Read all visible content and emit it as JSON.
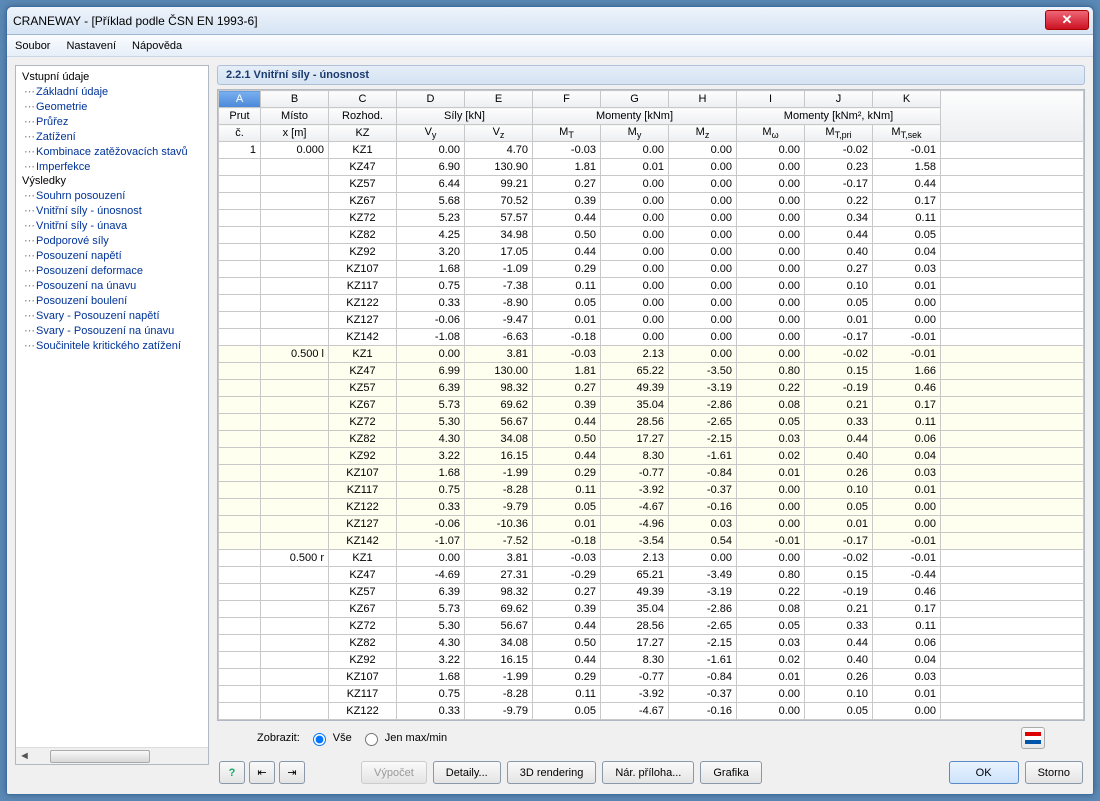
{
  "window": {
    "title": "CRANEWAY - [Příklad podle ČSN EN 1993-6]"
  },
  "menu": {
    "items": [
      "Soubor",
      "Nastavení",
      "Nápověda"
    ]
  },
  "nav": {
    "input_header": "Vstupní údaje",
    "input_items": [
      "Základní údaje",
      "Geometrie",
      "Průřez",
      "Zatížení",
      "Kombinace zatěžovacích stavů",
      "Imperfekce"
    ],
    "results_header": "Výsledky",
    "results_items": [
      "Souhrn posouzení",
      "Vnitřní síly - únosnost",
      "Vnitřní síly - únava",
      "Podporové síly",
      "Posouzení napětí",
      "Posouzení deformace",
      "Posouzení na únavu",
      "Posouzení boulení",
      "Svary - Posouzení napětí",
      "Svary - Posouzení na únavu",
      "Součinitele kritického zatížení"
    ]
  },
  "section": {
    "title": "2.2.1 Vnitřní síly - únosnost"
  },
  "columns": {
    "letters": [
      "A",
      "B",
      "C",
      "D",
      "E",
      "F",
      "G",
      "H",
      "I",
      "J",
      "K"
    ],
    "group_sily": "Síly [kN]",
    "group_momenty1": "Momenty [kNm]",
    "group_momenty2": "Momenty [kNm², kNm]",
    "row2": {
      "prut": "Prut",
      "misto": "Místo",
      "rozhod": "Rozhod."
    },
    "row3": {
      "c": "č.",
      "x": "x [m]",
      "kz": "KZ",
      "vy": "V",
      "vz": "V",
      "mt": "M",
      "my": "M",
      "mz": "M",
      "mw": "M",
      "mtpri": "M",
      "mtsek": "M"
    }
  },
  "rows": [
    {
      "prut": "1",
      "x": "0.000",
      "kz": "KZ1",
      "vy": "0.00",
      "vz": "4.70",
      "mt": "-0.03",
      "my": "0.00",
      "mz": "0.00",
      "mw": "0.00",
      "mtp": "-0.02",
      "mts": "-0.01",
      "alt": false
    },
    {
      "prut": "",
      "x": "",
      "kz": "KZ47",
      "vy": "6.90",
      "vz": "130.90",
      "mt": "1.81",
      "my": "0.01",
      "mz": "0.00",
      "mw": "0.00",
      "mtp": "0.23",
      "mts": "1.58",
      "alt": false
    },
    {
      "prut": "",
      "x": "",
      "kz": "KZ57",
      "vy": "6.44",
      "vz": "99.21",
      "mt": "0.27",
      "my": "0.00",
      "mz": "0.00",
      "mw": "0.00",
      "mtp": "-0.17",
      "mts": "0.44",
      "alt": false
    },
    {
      "prut": "",
      "x": "",
      "kz": "KZ67",
      "vy": "5.68",
      "vz": "70.52",
      "mt": "0.39",
      "my": "0.00",
      "mz": "0.00",
      "mw": "0.00",
      "mtp": "0.22",
      "mts": "0.17",
      "alt": false
    },
    {
      "prut": "",
      "x": "",
      "kz": "KZ72",
      "vy": "5.23",
      "vz": "57.57",
      "mt": "0.44",
      "my": "0.00",
      "mz": "0.00",
      "mw": "0.00",
      "mtp": "0.34",
      "mts": "0.11",
      "alt": false
    },
    {
      "prut": "",
      "x": "",
      "kz": "KZ82",
      "vy": "4.25",
      "vz": "34.98",
      "mt": "0.50",
      "my": "0.00",
      "mz": "0.00",
      "mw": "0.00",
      "mtp": "0.44",
      "mts": "0.05",
      "alt": false
    },
    {
      "prut": "",
      "x": "",
      "kz": "KZ92",
      "vy": "3.20",
      "vz": "17.05",
      "mt": "0.44",
      "my": "0.00",
      "mz": "0.00",
      "mw": "0.00",
      "mtp": "0.40",
      "mts": "0.04",
      "alt": false
    },
    {
      "prut": "",
      "x": "",
      "kz": "KZ107",
      "vy": "1.68",
      "vz": "-1.09",
      "mt": "0.29",
      "my": "0.00",
      "mz": "0.00",
      "mw": "0.00",
      "mtp": "0.27",
      "mts": "0.03",
      "alt": false
    },
    {
      "prut": "",
      "x": "",
      "kz": "KZ117",
      "vy": "0.75",
      "vz": "-7.38",
      "mt": "0.11",
      "my": "0.00",
      "mz": "0.00",
      "mw": "0.00",
      "mtp": "0.10",
      "mts": "0.01",
      "alt": false
    },
    {
      "prut": "",
      "x": "",
      "kz": "KZ122",
      "vy": "0.33",
      "vz": "-8.90",
      "mt": "0.05",
      "my": "0.00",
      "mz": "0.00",
      "mw": "0.00",
      "mtp": "0.05",
      "mts": "0.00",
      "alt": false
    },
    {
      "prut": "",
      "x": "",
      "kz": "KZ127",
      "vy": "-0.06",
      "vz": "-9.47",
      "mt": "0.01",
      "my": "0.00",
      "mz": "0.00",
      "mw": "0.00",
      "mtp": "0.01",
      "mts": "0.00",
      "alt": false
    },
    {
      "prut": "",
      "x": "",
      "kz": "KZ142",
      "vy": "-1.08",
      "vz": "-6.63",
      "mt": "-0.18",
      "my": "0.00",
      "mz": "0.00",
      "mw": "0.00",
      "mtp": "-0.17",
      "mts": "-0.01",
      "alt": false
    },
    {
      "prut": "",
      "x": "0.500 l",
      "kz": "KZ1",
      "vy": "0.00",
      "vz": "3.81",
      "mt": "-0.03",
      "my": "2.13",
      "mz": "0.00",
      "mw": "0.00",
      "mtp": "-0.02",
      "mts": "-0.01",
      "alt": true
    },
    {
      "prut": "",
      "x": "",
      "kz": "KZ47",
      "vy": "6.99",
      "vz": "130.00",
      "mt": "1.81",
      "my": "65.22",
      "mz": "-3.50",
      "mw": "0.80",
      "mtp": "0.15",
      "mts": "1.66",
      "alt": true
    },
    {
      "prut": "",
      "x": "",
      "kz": "KZ57",
      "vy": "6.39",
      "vz": "98.32",
      "mt": "0.27",
      "my": "49.39",
      "mz": "-3.19",
      "mw": "0.22",
      "mtp": "-0.19",
      "mts": "0.46",
      "alt": true
    },
    {
      "prut": "",
      "x": "",
      "kz": "KZ67",
      "vy": "5.73",
      "vz": "69.62",
      "mt": "0.39",
      "my": "35.04",
      "mz": "-2.86",
      "mw": "0.08",
      "mtp": "0.21",
      "mts": "0.17",
      "alt": true
    },
    {
      "prut": "",
      "x": "",
      "kz": "KZ72",
      "vy": "5.30",
      "vz": "56.67",
      "mt": "0.44",
      "my": "28.56",
      "mz": "-2.65",
      "mw": "0.05",
      "mtp": "0.33",
      "mts": "0.11",
      "alt": true
    },
    {
      "prut": "",
      "x": "",
      "kz": "KZ82",
      "vy": "4.30",
      "vz": "34.08",
      "mt": "0.50",
      "my": "17.27",
      "mz": "-2.15",
      "mw": "0.03",
      "mtp": "0.44",
      "mts": "0.06",
      "alt": true
    },
    {
      "prut": "",
      "x": "",
      "kz": "KZ92",
      "vy": "3.22",
      "vz": "16.15",
      "mt": "0.44",
      "my": "8.30",
      "mz": "-1.61",
      "mw": "0.02",
      "mtp": "0.40",
      "mts": "0.04",
      "alt": true
    },
    {
      "prut": "",
      "x": "",
      "kz": "KZ107",
      "vy": "1.68",
      "vz": "-1.99",
      "mt": "0.29",
      "my": "-0.77",
      "mz": "-0.84",
      "mw": "0.01",
      "mtp": "0.26",
      "mts": "0.03",
      "alt": true
    },
    {
      "prut": "",
      "x": "",
      "kz": "KZ117",
      "vy": "0.75",
      "vz": "-8.28",
      "mt": "0.11",
      "my": "-3.92",
      "mz": "-0.37",
      "mw": "0.00",
      "mtp": "0.10",
      "mts": "0.01",
      "alt": true
    },
    {
      "prut": "",
      "x": "",
      "kz": "KZ122",
      "vy": "0.33",
      "vz": "-9.79",
      "mt": "0.05",
      "my": "-4.67",
      "mz": "-0.16",
      "mw": "0.00",
      "mtp": "0.05",
      "mts": "0.00",
      "alt": true
    },
    {
      "prut": "",
      "x": "",
      "kz": "KZ127",
      "vy": "-0.06",
      "vz": "-10.36",
      "mt": "0.01",
      "my": "-4.96",
      "mz": "0.03",
      "mw": "0.00",
      "mtp": "0.01",
      "mts": "0.00",
      "alt": true
    },
    {
      "prut": "",
      "x": "",
      "kz": "KZ142",
      "vy": "-1.07",
      "vz": "-7.52",
      "mt": "-0.18",
      "my": "-3.54",
      "mz": "0.54",
      "mw": "-0.01",
      "mtp": "-0.17",
      "mts": "-0.01",
      "alt": true
    },
    {
      "prut": "",
      "x": "0.500 r",
      "kz": "KZ1",
      "vy": "0.00",
      "vz": "3.81",
      "mt": "-0.03",
      "my": "2.13",
      "mz": "0.00",
      "mw": "0.00",
      "mtp": "-0.02",
      "mts": "-0.01",
      "alt": false
    },
    {
      "prut": "",
      "x": "",
      "kz": "KZ47",
      "vy": "-4.69",
      "vz": "27.31",
      "mt": "-0.29",
      "my": "65.21",
      "mz": "-3.49",
      "mw": "0.80",
      "mtp": "0.15",
      "mts": "-0.44",
      "alt": false
    },
    {
      "prut": "",
      "x": "",
      "kz": "KZ57",
      "vy": "6.39",
      "vz": "98.32",
      "mt": "0.27",
      "my": "49.39",
      "mz": "-3.19",
      "mw": "0.22",
      "mtp": "-0.19",
      "mts": "0.46",
      "alt": false
    },
    {
      "prut": "",
      "x": "",
      "kz": "KZ67",
      "vy": "5.73",
      "vz": "69.62",
      "mt": "0.39",
      "my": "35.04",
      "mz": "-2.86",
      "mw": "0.08",
      "mtp": "0.21",
      "mts": "0.17",
      "alt": false
    },
    {
      "prut": "",
      "x": "",
      "kz": "KZ72",
      "vy": "5.30",
      "vz": "56.67",
      "mt": "0.44",
      "my": "28.56",
      "mz": "-2.65",
      "mw": "0.05",
      "mtp": "0.33",
      "mts": "0.11",
      "alt": false
    },
    {
      "prut": "",
      "x": "",
      "kz": "KZ82",
      "vy": "4.30",
      "vz": "34.08",
      "mt": "0.50",
      "my": "17.27",
      "mz": "-2.15",
      "mw": "0.03",
      "mtp": "0.44",
      "mts": "0.06",
      "alt": false
    },
    {
      "prut": "",
      "x": "",
      "kz": "KZ92",
      "vy": "3.22",
      "vz": "16.15",
      "mt": "0.44",
      "my": "8.30",
      "mz": "-1.61",
      "mw": "0.02",
      "mtp": "0.40",
      "mts": "0.04",
      "alt": false
    },
    {
      "prut": "",
      "x": "",
      "kz": "KZ107",
      "vy": "1.68",
      "vz": "-1.99",
      "mt": "0.29",
      "my": "-0.77",
      "mz": "-0.84",
      "mw": "0.01",
      "mtp": "0.26",
      "mts": "0.03",
      "alt": false
    },
    {
      "prut": "",
      "x": "",
      "kz": "KZ117",
      "vy": "0.75",
      "vz": "-8.28",
      "mt": "0.11",
      "my": "-3.92",
      "mz": "-0.37",
      "mw": "0.00",
      "mtp": "0.10",
      "mts": "0.01",
      "alt": false
    },
    {
      "prut": "",
      "x": "",
      "kz": "KZ122",
      "vy": "0.33",
      "vz": "-9.79",
      "mt": "0.05",
      "my": "-4.67",
      "mz": "-0.16",
      "mw": "0.00",
      "mtp": "0.05",
      "mts": "0.00",
      "alt": false
    }
  ],
  "filter": {
    "label": "Zobrazit:",
    "all": "Vše",
    "maxmin": "Jen max/min"
  },
  "footer": {
    "vypocet": "Výpočet",
    "detaily": "Detaily...",
    "render": "3D rendering",
    "priloha": "Nár. příloha...",
    "grafika": "Grafika",
    "ok": "OK",
    "storno": "Storno"
  }
}
